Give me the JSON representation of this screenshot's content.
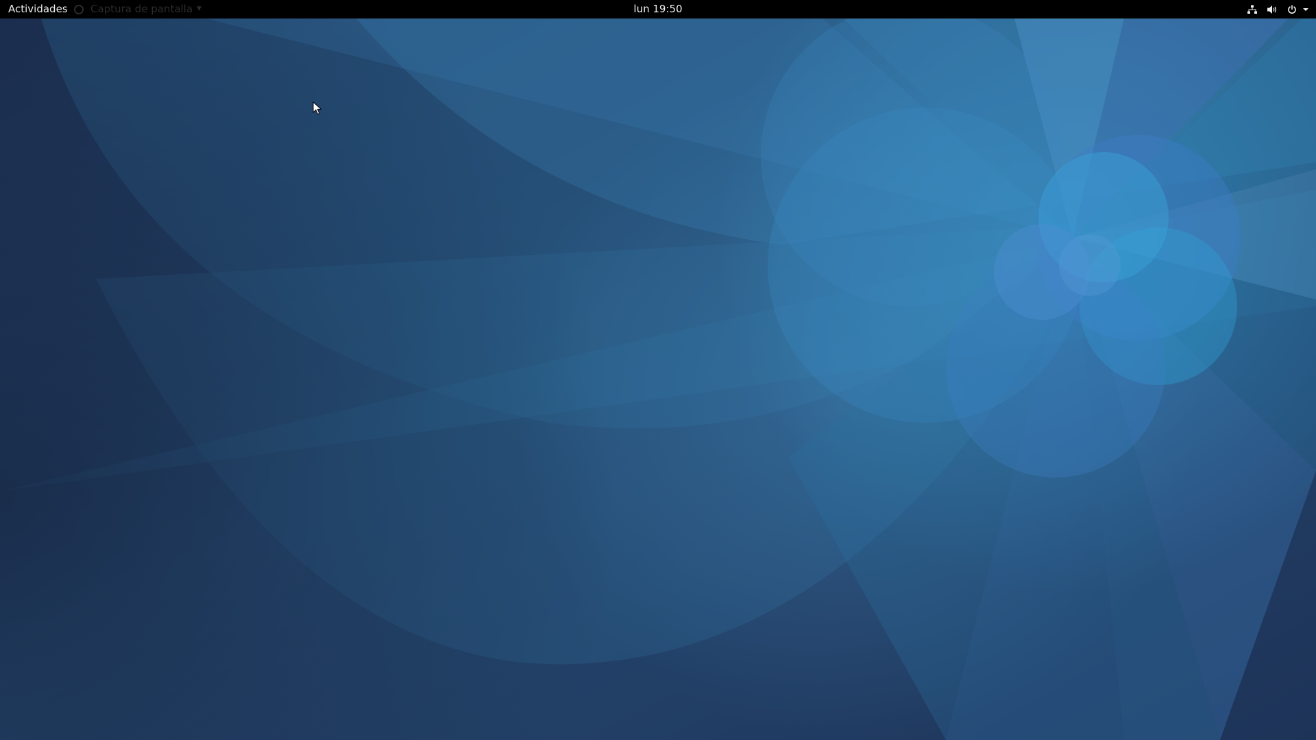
{
  "top_bar": {
    "activities_label": "Actividades",
    "app_menu_label": "Captura de pantalla",
    "clock": "lun 19:50",
    "status_icons": [
      "network-wired-icon",
      "volume-icon",
      "power-icon",
      "chevron-down-icon"
    ]
  },
  "colors": {
    "top_bar_bg": "#000000",
    "top_bar_text": "#eeeeec",
    "wallpaper_base": "#1f3355",
    "wallpaper_accent": "#3aa0d0"
  },
  "desktop": {
    "wallpaper_icon": "fedora-blue-petal-wallpaper",
    "cursor_icon": "pointer-arrow-icon"
  }
}
